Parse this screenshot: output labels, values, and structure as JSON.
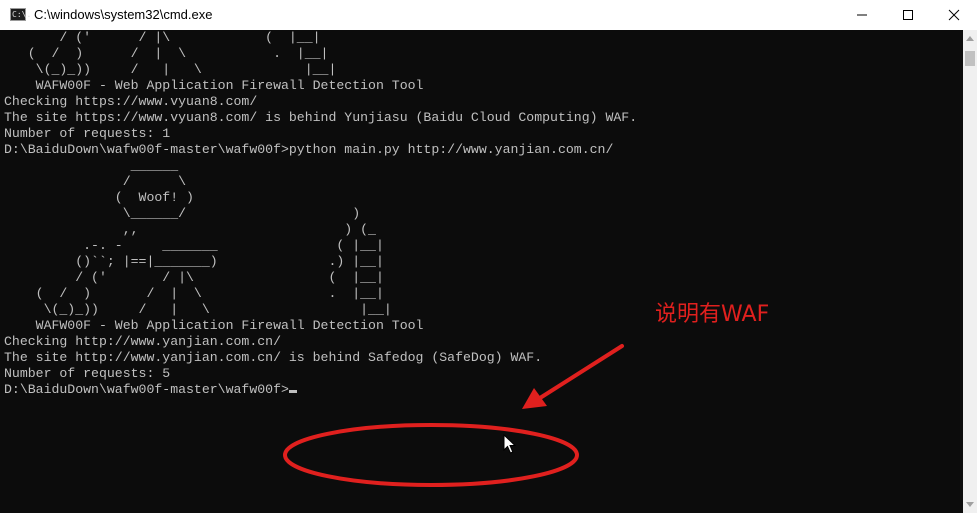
{
  "window": {
    "title": "C:\\windows\\system32\\cmd.exe",
    "icon_label": "C:\\.",
    "icons": [
      "cmd-app-icon",
      "minimize-icon",
      "maximize-icon",
      "close-icon"
    ]
  },
  "console": {
    "lines": [
      "       / ('      / |\\            (  |__|",
      "   (  /  )      /  |  \\           .  |__|",
      "    \\(_)_))     /   |   \\             |__|",
      "",
      "    WAFW00F - Web Application Firewall Detection Tool",
      "",
      "Checking https://www.vyuan8.com/",
      "The site https://www.vyuan8.com/ is behind Yunjiasu (Baidu Cloud Computing) WAF.",
      "Number of requests: 1",
      "",
      "D:\\BaiduDown\\wafw00f-master\\wafw00f>python main.py http://www.yanjian.com.cn/",
      "",
      "                ______",
      "               /      \\",
      "              (  Woof! )",
      "               \\______/                     )",
      "               ,,                          ) (_",
      "          .-. -     _______               ( |__|",
      "         ()``; |==|_______)              .) |__|",
      "         / ('       / |\\                 (  |__|",
      "    (  /  )       /  |  \\                .  |__|",
      "     \\(_)_))     /   |   \\                   |__|",
      "",
      "    WAFW00F - Web Application Firewall Detection Tool",
      "",
      "Checking http://www.yanjian.com.cn/",
      "The site http://www.yanjian.com.cn/ is behind Safedog (SafeDog) WAF.",
      "Number of requests: 5",
      "",
      "D:\\BaiduDown\\wafw00f-master\\wafw00f>"
    ]
  },
  "annotation": {
    "text": "说明有WAF",
    "color": "#e0201e"
  },
  "colors": {
    "console_bg": "#0c0c0c",
    "console_fg": "#c0c0c0",
    "highlight_red": "#e0201e",
    "titlebar_bg": "#ffffff"
  }
}
